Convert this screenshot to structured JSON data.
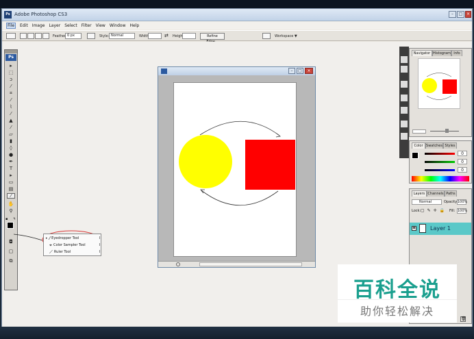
{
  "window": {
    "title": "Adobe Photoshop CS3",
    "logo_text": "Ps"
  },
  "menu": [
    "File",
    "Edit",
    "Image",
    "Layer",
    "Select",
    "Filter",
    "View",
    "Window",
    "Help"
  ],
  "options_bar": {
    "feather_label": "Feather:",
    "feather_value": "0 px",
    "style_label": "Style:",
    "style_value": "Normal",
    "width_label": "Width:",
    "height_label": "Height:",
    "refine_edge": "Refine Edge...",
    "workspace": "Workspace ▼"
  },
  "toolbox": {
    "badge": "Ps"
  },
  "flyout": {
    "items": [
      "Eyedropper Tool",
      "Color Sampler Tool",
      "Ruler Tool"
    ],
    "shortcut": "I"
  },
  "navigator_panel": {
    "tabs": [
      "Navigator",
      "Histogram",
      "Info"
    ]
  },
  "color_panel": {
    "tabs": [
      "Color",
      "Swatches",
      "Styles"
    ],
    "values": [
      "0",
      "0",
      "0"
    ]
  },
  "layers_panel": {
    "tabs": [
      "Layers",
      "Channels",
      "Paths"
    ],
    "blend_mode": "Normal",
    "opacity_label": "Opacity:",
    "opacity_value": "100%",
    "lock_label": "Lock:",
    "fill_label": "Fill:",
    "fill_value": "100%",
    "layer_name": "Layer 1"
  },
  "document": {
    "circle_color": "#ffff00",
    "square_color": "#ff0000"
  },
  "watermark": {
    "title": "百科全说",
    "subtitle": "助你轻松解决"
  },
  "colors": {
    "accent": "#1a9f8e",
    "highlight_layer": "#5ac8c8",
    "badge": "#2c5aa0"
  }
}
